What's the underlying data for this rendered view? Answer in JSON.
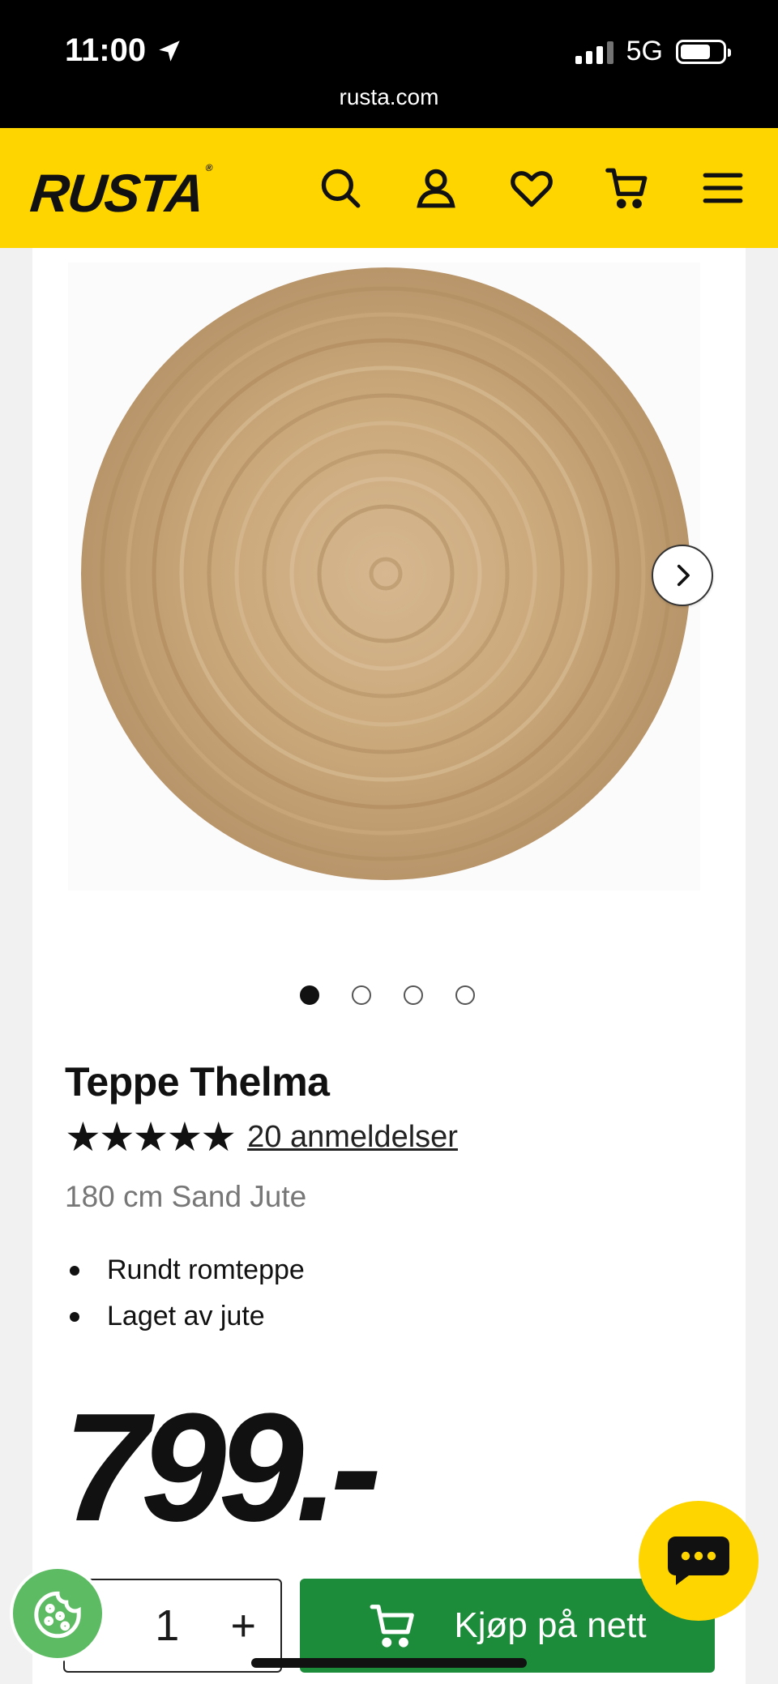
{
  "status_bar": {
    "time": "11:00",
    "network": "5G",
    "battery_level": 0.72,
    "url": "rusta.com"
  },
  "header": {
    "logo": "RUSTA",
    "icons": [
      "search-icon",
      "account-icon",
      "heart-icon",
      "cart-icon",
      "menu-icon"
    ],
    "background": "#ffd500"
  },
  "product": {
    "title": "Teppe Thelma",
    "rating": 5,
    "stars": "★★★★★",
    "reviews_label": "20 anmeldelser",
    "variant": "180 cm Sand Jute",
    "features": [
      "Rundt romteppe",
      "Laget av jute"
    ],
    "price": "799.-",
    "carousel": {
      "total": 4,
      "active": 1
    }
  },
  "purchase": {
    "quantity": "1",
    "minus": "-",
    "plus": "+",
    "buy_label": "Kjøp på nett",
    "buy_color": "#1c8c3b"
  }
}
